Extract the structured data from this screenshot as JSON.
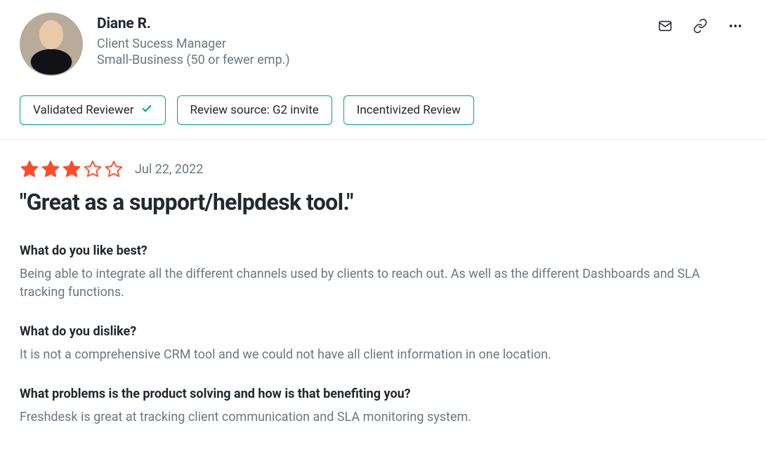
{
  "reviewer": {
    "name": "Diane R.",
    "title": "Client Sucess Manager",
    "company_size": "Small-Business (50 or fewer emp.)"
  },
  "badges": {
    "validated": "Validated Reviewer",
    "source": "Review source: G2 invite",
    "incentivized": "Incentivized Review"
  },
  "review": {
    "rating": 3,
    "date": "Jul 22, 2022",
    "title": "\"Great as a support/helpdesk tool.\"",
    "qa": [
      {
        "question": "What do you like best?",
        "answer": "Being able to integrate all the different channels used by clients to reach out. As well as the different Dashboards and SLA tracking functions."
      },
      {
        "question": "What do you dislike?",
        "answer": "It is not a comprehensive CRM tool and we could not have all client information in one location."
      },
      {
        "question": "What problems is the product solving and how is that benefiting you?",
        "answer": "Freshdesk is great at tracking client communication and SLA monitoring system."
      }
    ]
  },
  "colors": {
    "brand_accent": "#00AA6C",
    "star_fill": "#FF4B2B",
    "text_primary": "#23292E",
    "text_muted": "#6A7780"
  }
}
